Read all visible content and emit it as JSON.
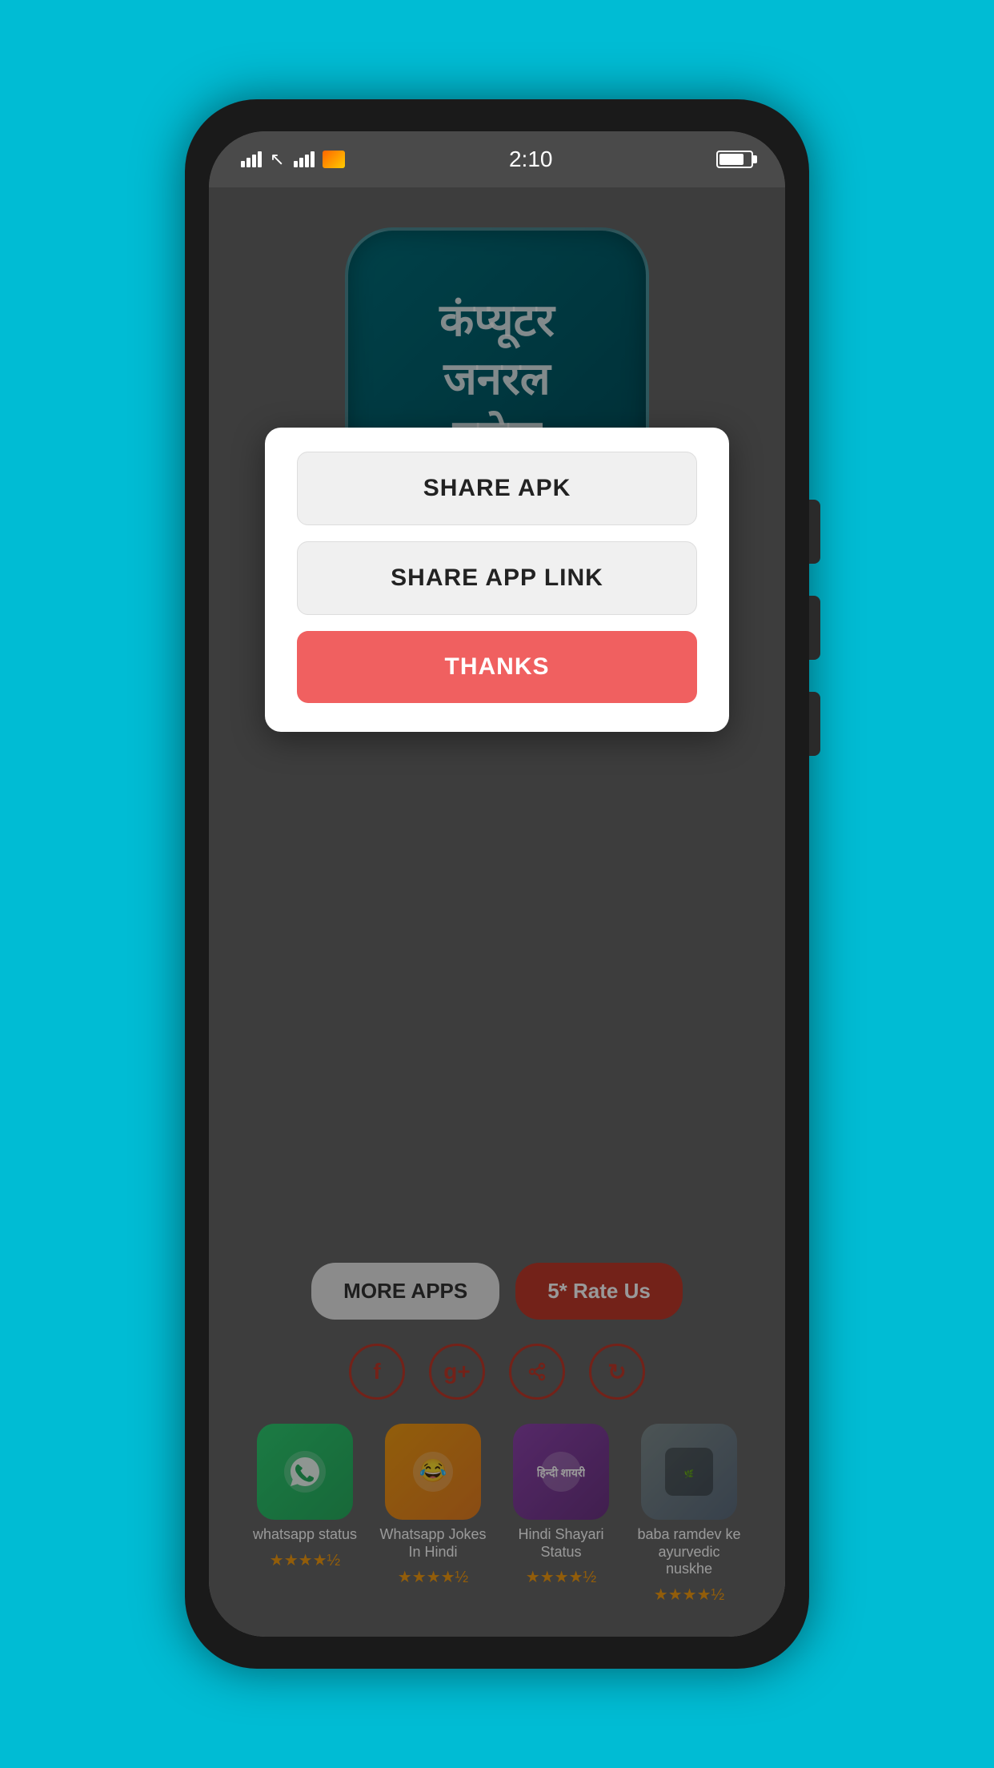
{
  "phone": {
    "status_bar": {
      "time": "2:10"
    }
  },
  "app_logo": {
    "text_line1": "कंप्यूटर",
    "text_line2": "जनरल",
    "text_line3": "नलेज"
  },
  "modal": {
    "share_apk_label": "SHARE APK",
    "share_link_label": "SHARE APP LINK",
    "thanks_label": "THANKS"
  },
  "bottom": {
    "more_apps_label": "MORE APPS",
    "rate_us_label": "5* Rate Us",
    "social_icons": [
      {
        "name": "facebook",
        "symbol": "f"
      },
      {
        "name": "google-plus",
        "symbol": "g+"
      },
      {
        "name": "share",
        "symbol": "◁"
      },
      {
        "name": "refresh",
        "symbol": "↻"
      }
    ],
    "apps": [
      {
        "label": "whatsapp status",
        "stars": "★★★★½"
      },
      {
        "label": "Whatsapp Jokes In Hindi",
        "stars": "★★★★½"
      },
      {
        "label": "Hindi Shayari Status",
        "stars": "★★★★½"
      },
      {
        "label": "baba ramdev ke ayurvedic nuskhe",
        "stars": "★★★★½"
      }
    ]
  }
}
